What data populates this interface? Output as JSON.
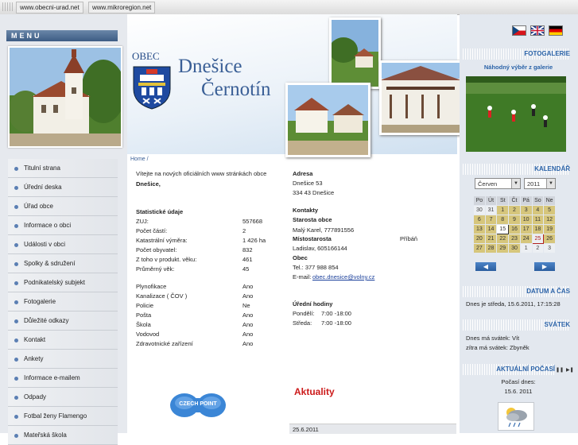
{
  "topbar": {
    "link1": "www.obecni-urad.net",
    "link2": "www.mikroregion.net"
  },
  "menu": {
    "heading": "MENU",
    "items": [
      "Titulní strana",
      "Úřední deska",
      "Úřad obce",
      "Informace o obci",
      "Události v obci",
      "Spolky & sdružení",
      "Podnikatelský subjekt",
      "Fotogalerie",
      "Důležité odkazy",
      "Kontakt",
      "Ankety",
      "Informace e-mailem",
      "Odpady",
      "Fotbal ženy Flamengo",
      "Mateřská škola"
    ]
  },
  "header": {
    "obec": "OBEC",
    "title_line1": "Dnešice",
    "title_line2": "Černotín"
  },
  "breadcrumb": "Home  /",
  "welcome": {
    "line1": "Vítejte na nových oficiálních www stránkách obce",
    "line2": "Dnešice,"
  },
  "stats": {
    "heading": "Statistické údaje",
    "rows": [
      {
        "label": "ZUJ:",
        "value": "557668"
      },
      {
        "label": "Počet částí:",
        "value": "2"
      },
      {
        "label": "Katastrální výměra:",
        "value": "1 426 ha"
      },
      {
        "label": "Počet obyvatel:",
        "value": "832"
      },
      {
        "label": "Z toho v produkt. věku:",
        "value": "461"
      },
      {
        "label": "Průměrný věk:",
        "value": "45"
      }
    ],
    "amenities": [
      {
        "label": "Plynofikace",
        "value": "Ano"
      },
      {
        "label": "Kanalizace ( ČOV )",
        "value": "Ano"
      },
      {
        "label": "Policie",
        "value": "Ne"
      },
      {
        "label": "Pošta",
        "value": "Ano"
      },
      {
        "label": "Škola",
        "value": "Ano"
      },
      {
        "label": "Vodovod",
        "value": "Ano"
      },
      {
        "label": "Zdravotnické zařízení",
        "value": "Ano"
      }
    ]
  },
  "address": {
    "heading": "Adresa",
    "line1": "Dnešice 53",
    "line2": "334 43   Dnešice"
  },
  "contacts": {
    "heading": "Kontakty",
    "starosta_heading": "Starosta obce",
    "starosta": "Malý Karel, 777891556",
    "mistostarosta_heading": "Místostarosta",
    "mistostarosta_surname": "Příbáň",
    "mistostarosta_line": "Ladislav, 605166144",
    "obec_heading": "Obec",
    "tel": "Tel.: 377 988 854",
    "email_label": "E-mail:",
    "email": "obec.dnesice@volny.cz"
  },
  "hours": {
    "heading": "Úřední hodiny",
    "rows": [
      {
        "day": "Pondělí:",
        "time": "7:00 -18:00"
      },
      {
        "day": "Středa:",
        "time": "7:00 -18:00"
      }
    ]
  },
  "czechpoint": "CZECH POINT",
  "news": {
    "heading": "Aktuality",
    "date": "25.6.2011"
  },
  "fotogalerie": {
    "heading": "FOTOGALERIE",
    "subtitle": "Náhodný výběr z galerie"
  },
  "calendar": {
    "heading": "KALENDÁŘ",
    "month": "Červen",
    "year": "2011",
    "days": [
      "Po",
      "Út",
      "St",
      "Čt",
      "Pá",
      "So",
      "Ne"
    ],
    "weeks": [
      [
        {
          "d": "30",
          "t": "o"
        },
        {
          "d": "31",
          "t": "o"
        },
        {
          "d": "1",
          "t": "e"
        },
        {
          "d": "2",
          "t": "e"
        },
        {
          "d": "3",
          "t": "e"
        },
        {
          "d": "4",
          "t": "e"
        },
        {
          "d": "5",
          "t": "e"
        }
      ],
      [
        {
          "d": "6",
          "t": "e"
        },
        {
          "d": "7",
          "t": "e"
        },
        {
          "d": "8",
          "t": "e"
        },
        {
          "d": "9",
          "t": "e"
        },
        {
          "d": "10",
          "t": "e"
        },
        {
          "d": "11",
          "t": "e"
        },
        {
          "d": "12",
          "t": "e"
        }
      ],
      [
        {
          "d": "13",
          "t": "e"
        },
        {
          "d": "14",
          "t": "e"
        },
        {
          "d": "15",
          "t": "td"
        },
        {
          "d": "16",
          "t": "e"
        },
        {
          "d": "17",
          "t": "e"
        },
        {
          "d": "18",
          "t": "e"
        },
        {
          "d": "19",
          "t": "e"
        }
      ],
      [
        {
          "d": "20",
          "t": "e"
        },
        {
          "d": "21",
          "t": "e"
        },
        {
          "d": "22",
          "t": "e"
        },
        {
          "d": "23",
          "t": "e"
        },
        {
          "d": "24",
          "t": "e"
        },
        {
          "d": "25",
          "t": "w"
        },
        {
          "d": "26",
          "t": "e"
        }
      ],
      [
        {
          "d": "27",
          "t": "e"
        },
        {
          "d": "28",
          "t": "e"
        },
        {
          "d": "29",
          "t": "e"
        },
        {
          "d": "30",
          "t": "e"
        },
        {
          "d": "1",
          "t": "o"
        },
        {
          "d": "2",
          "t": "o"
        },
        {
          "d": "3",
          "t": "o"
        }
      ]
    ],
    "prev": "◀",
    "next": "▶"
  },
  "datetime": {
    "heading": "DATUM A ČAS",
    "text": "Dnes je středa, 15.6.2011, 17:15:28"
  },
  "svatek": {
    "heading": "SVÁTEK",
    "today": "Dnes má svátek: Vít",
    "tomorrow": "zítra má svátek: Zbyněk"
  },
  "weather": {
    "heading": "AKTUÁLNÍ POČASÍ",
    "line1": "Počasí dnes:",
    "line2": "15.6. 2011"
  },
  "colors": {
    "accent": "#2b63a8",
    "calendar_day": "#d6c67c",
    "news_red": "#cc1a1a"
  }
}
